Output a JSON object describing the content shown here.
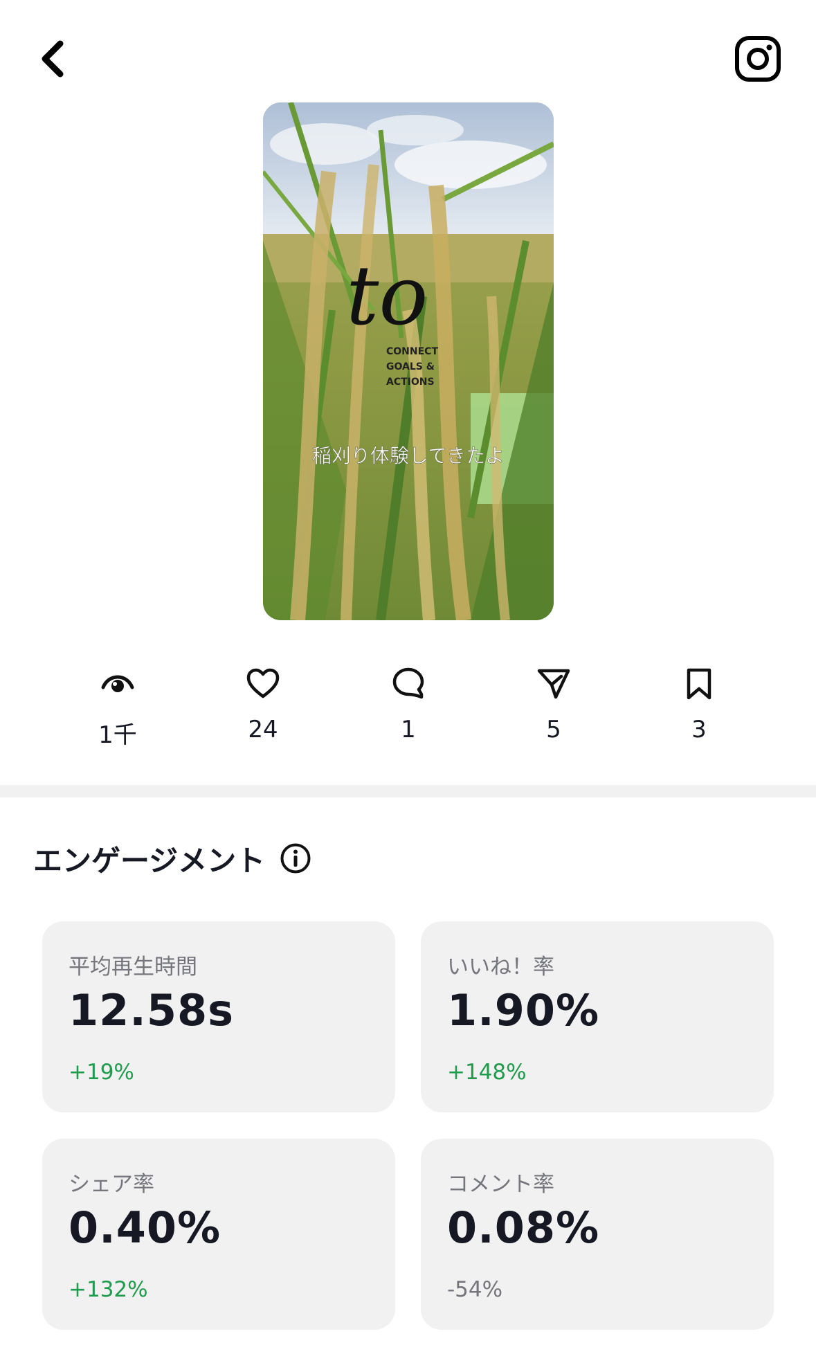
{
  "header": {
    "back_icon": "chevron-left-icon",
    "instagram_icon": "instagram-icon"
  },
  "video": {
    "logo_text": "to",
    "logo_sub_lines": [
      "CONNECT",
      "GOALS &",
      "ACTIONS"
    ],
    "caption": "稲刈り体験してきたよ"
  },
  "stats": [
    {
      "key": "views",
      "icon": "eye-icon",
      "value": "1千"
    },
    {
      "key": "likes",
      "icon": "heart-icon",
      "value": "24"
    },
    {
      "key": "comments",
      "icon": "comment-icon",
      "value": "1"
    },
    {
      "key": "shares",
      "icon": "share-icon",
      "value": "5"
    },
    {
      "key": "saves",
      "icon": "bookmark-icon",
      "value": "3"
    }
  ],
  "engagement": {
    "title": "エンゲージメント",
    "info_icon": "info-icon",
    "cards": [
      {
        "label": "平均再生時間",
        "value": "12.58s",
        "change": "+19%",
        "trend": "up"
      },
      {
        "label": "いいね！率",
        "value": "1.90%",
        "change": "+148%",
        "trend": "up"
      },
      {
        "label": "シェア率",
        "value": "0.40%",
        "change": "+132%",
        "trend": "up"
      },
      {
        "label": "コメント率",
        "value": "0.08%",
        "change": "-54%",
        "trend": "down"
      }
    ]
  },
  "colors": {
    "positive": "#1e9b4b",
    "negative": "#75767c",
    "card_bg": "#f1f1f2",
    "text": "#161823"
  }
}
